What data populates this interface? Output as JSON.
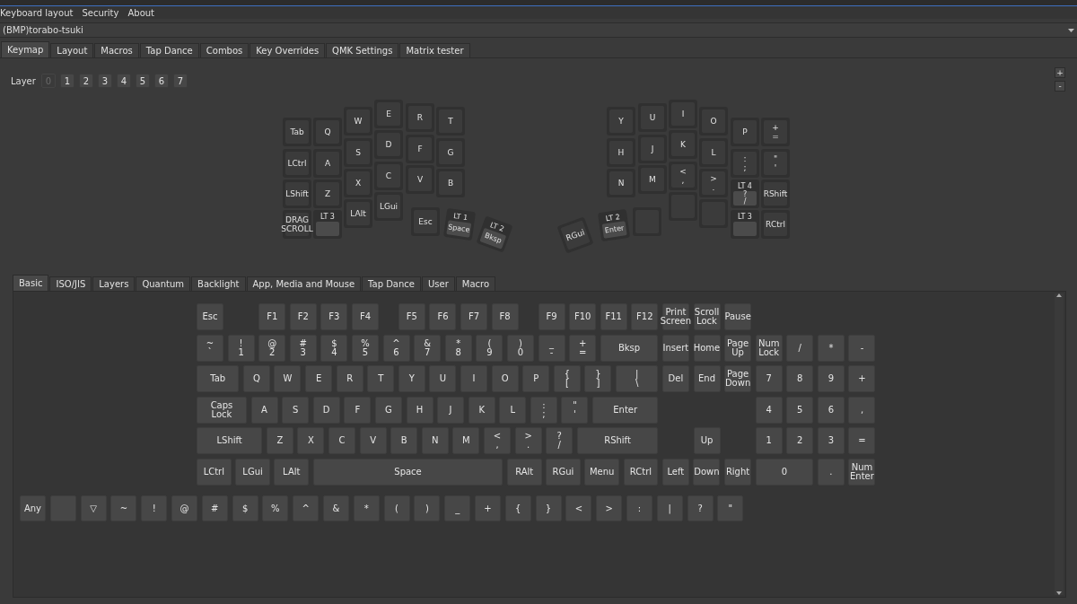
{
  "menu": [
    "Keyboard layout",
    "Security",
    "About"
  ],
  "device": {
    "value": "(BMP)torabo-tsuki"
  },
  "tabs": [
    {
      "label": "Keymap",
      "selected": true
    },
    {
      "label": "Layout",
      "selected": false
    },
    {
      "label": "Macros",
      "selected": false
    },
    {
      "label": "Tap Dance",
      "selected": false
    },
    {
      "label": "Combos",
      "selected": false
    },
    {
      "label": "Key Overrides",
      "selected": false
    },
    {
      "label": "QMK Settings",
      "selected": false
    },
    {
      "label": "Matrix tester",
      "selected": false
    }
  ],
  "layers": {
    "label": "Layer",
    "items": [
      {
        "label": "0",
        "selected": true
      },
      {
        "label": "1",
        "selected": false
      },
      {
        "label": "2",
        "selected": false
      },
      {
        "label": "3",
        "selected": false
      },
      {
        "label": "4",
        "selected": false
      },
      {
        "label": "5",
        "selected": false
      },
      {
        "label": "6",
        "selected": false
      },
      {
        "label": "7",
        "selected": false
      }
    ]
  },
  "zoom_buttons": [
    "+",
    "-"
  ],
  "split_keyboard": {
    "left": [
      {
        "kind": "basic",
        "label": "Tab"
      },
      {
        "kind": "basic",
        "label": "LCtrl"
      },
      {
        "kind": "basic",
        "label": "LShift"
      },
      {
        "kind": "basic",
        "label": "DRAG\nSCROLL"
      },
      {
        "kind": "basic",
        "label": "Q"
      },
      {
        "kind": "basic",
        "label": "A"
      },
      {
        "kind": "basic",
        "label": "Z"
      },
      {
        "kind": "layer",
        "top": "LT 3"
      },
      {
        "kind": "basic",
        "label": "W"
      },
      {
        "kind": "basic",
        "label": "S"
      },
      {
        "kind": "basic",
        "label": "X"
      },
      {
        "kind": "basic",
        "label": "LAlt"
      },
      {
        "kind": "basic",
        "label": "E"
      },
      {
        "kind": "basic",
        "label": "D"
      },
      {
        "kind": "basic",
        "label": "C"
      },
      {
        "kind": "basic",
        "label": "LGui"
      },
      {
        "kind": "basic",
        "label": "R"
      },
      {
        "kind": "basic",
        "label": "F"
      },
      {
        "kind": "basic",
        "label": "V"
      },
      {
        "kind": "basic",
        "label": "T"
      },
      {
        "kind": "basic",
        "label": "G"
      },
      {
        "kind": "basic",
        "label": "B"
      },
      {
        "kind": "basic",
        "label": "Esc"
      },
      {
        "kind": "layer",
        "top": "LT 1",
        "label": "Space"
      },
      {
        "kind": "layer",
        "top": "LT 2",
        "label": "Bksp"
      }
    ],
    "right": [
      {
        "kind": "basic",
        "label": "Y"
      },
      {
        "kind": "basic",
        "label": "H"
      },
      {
        "kind": "basic",
        "label": "N"
      },
      {
        "kind": "basic",
        "label": "U"
      },
      {
        "kind": "basic",
        "label": "J"
      },
      {
        "kind": "basic",
        "label": "M"
      },
      {
        "kind": "basic",
        "label": "I"
      },
      {
        "kind": "basic",
        "label": "K"
      },
      {
        "kind": "basic",
        "label": "<\n,"
      },
      {
        "kind": "basic"
      },
      {
        "kind": "basic",
        "label": "O"
      },
      {
        "kind": "basic",
        "label": "L"
      },
      {
        "kind": "basic",
        "label": ">\n."
      },
      {
        "kind": "basic"
      },
      {
        "kind": "basic",
        "label": "P"
      },
      {
        "kind": "basic",
        "label": ":\n;"
      },
      {
        "kind": "layer",
        "top": "LT 4",
        "label": "?\n/"
      },
      {
        "kind": "layer",
        "top": "LT 3"
      },
      {
        "kind": "basic",
        "label": "+\n="
      },
      {
        "kind": "basic",
        "label": "\"\n'"
      },
      {
        "kind": "basic",
        "label": "RShift"
      },
      {
        "kind": "basic",
        "label": "RCtrl"
      },
      {
        "kind": "basic",
        "label": "RGui"
      },
      {
        "kind": "layer",
        "top": "LT 2",
        "label": "Enter"
      },
      {
        "kind": "basic"
      }
    ]
  },
  "keycode_tabs": [
    {
      "label": "Basic",
      "selected": true
    },
    {
      "label": "ISO/JIS",
      "selected": false
    },
    {
      "label": "Layers",
      "selected": false
    },
    {
      "label": "Quantum",
      "selected": false
    },
    {
      "label": "Backlight",
      "selected": false
    },
    {
      "label": "App, Media and Mouse",
      "selected": false
    },
    {
      "label": "Tap Dance",
      "selected": false
    },
    {
      "label": "User",
      "selected": false
    },
    {
      "label": "Macro",
      "selected": false
    }
  ],
  "keycode_rows": [
    [
      "Esc",
      "F1",
      "F2",
      "F3",
      "F4",
      "F5",
      "F6",
      "F7",
      "F8",
      "F9",
      "F10",
      "F11",
      "F12",
      "Print\nScreen",
      "Scroll\nLock",
      "Pause"
    ],
    [
      "~\n`",
      "!\n1",
      "@\n2",
      "#\n3",
      "$\n4",
      "%\n5",
      "^\n6",
      "&\n7",
      "*\n8",
      "(\n9",
      ")\n0",
      "_\n-",
      "+\n=",
      "Bksp",
      "Insert",
      "Home",
      "Page\nUp",
      "Num\nLock",
      "/",
      "*",
      "-"
    ],
    [
      "Tab",
      "Q",
      "W",
      "E",
      "R",
      "T",
      "Y",
      "U",
      "I",
      "O",
      "P",
      "{\n[",
      "}\n]",
      "|\n\\",
      "Del",
      "End",
      "Page\nDown",
      "7",
      "8",
      "9",
      "+"
    ],
    [
      "Caps\nLock",
      "A",
      "S",
      "D",
      "F",
      "G",
      "H",
      "J",
      "K",
      "L",
      ":\n;",
      "\"\n'",
      "Enter",
      "4",
      "5",
      "6",
      ","
    ],
    [
      "LShift",
      "Z",
      "X",
      "C",
      "V",
      "B",
      "N",
      "M",
      "<\n,",
      ">\n.",
      "?\n/",
      "RShift",
      "Up",
      "1",
      "2",
      "3",
      "="
    ],
    [
      "LCtrl",
      "LGui",
      "LAlt",
      "Space",
      "RAlt",
      "RGui",
      "Menu",
      "RCtrl",
      "Left",
      "Down",
      "Right",
      "0",
      ".",
      "Num\nEnter"
    ]
  ],
  "extra_keys": [
    {
      "kind": "key",
      "label": "Any"
    },
    {
      "kind": "blank"
    },
    {
      "kind": "key",
      "label": "▽"
    },
    {
      "kind": "key",
      "label": "~"
    },
    {
      "kind": "key",
      "label": "!"
    },
    {
      "kind": "key",
      "label": "@"
    },
    {
      "kind": "key",
      "label": "#"
    },
    {
      "kind": "key",
      "label": "$"
    },
    {
      "kind": "key",
      "label": "%"
    },
    {
      "kind": "key",
      "label": "^"
    },
    {
      "kind": "key",
      "label": "&"
    },
    {
      "kind": "key",
      "label": "*"
    },
    {
      "kind": "key",
      "label": "("
    },
    {
      "kind": "key",
      "label": ")"
    },
    {
      "kind": "key",
      "label": "_"
    },
    {
      "kind": "key",
      "label": "+"
    },
    {
      "kind": "key",
      "label": "{"
    },
    {
      "kind": "key",
      "label": "}"
    },
    {
      "kind": "key",
      "label": "<"
    },
    {
      "kind": "key",
      "label": ">"
    },
    {
      "kind": "key",
      "label": ":"
    },
    {
      "kind": "key",
      "label": "|"
    },
    {
      "kind": "key",
      "label": "?"
    },
    {
      "kind": "key",
      "label": "\""
    }
  ]
}
